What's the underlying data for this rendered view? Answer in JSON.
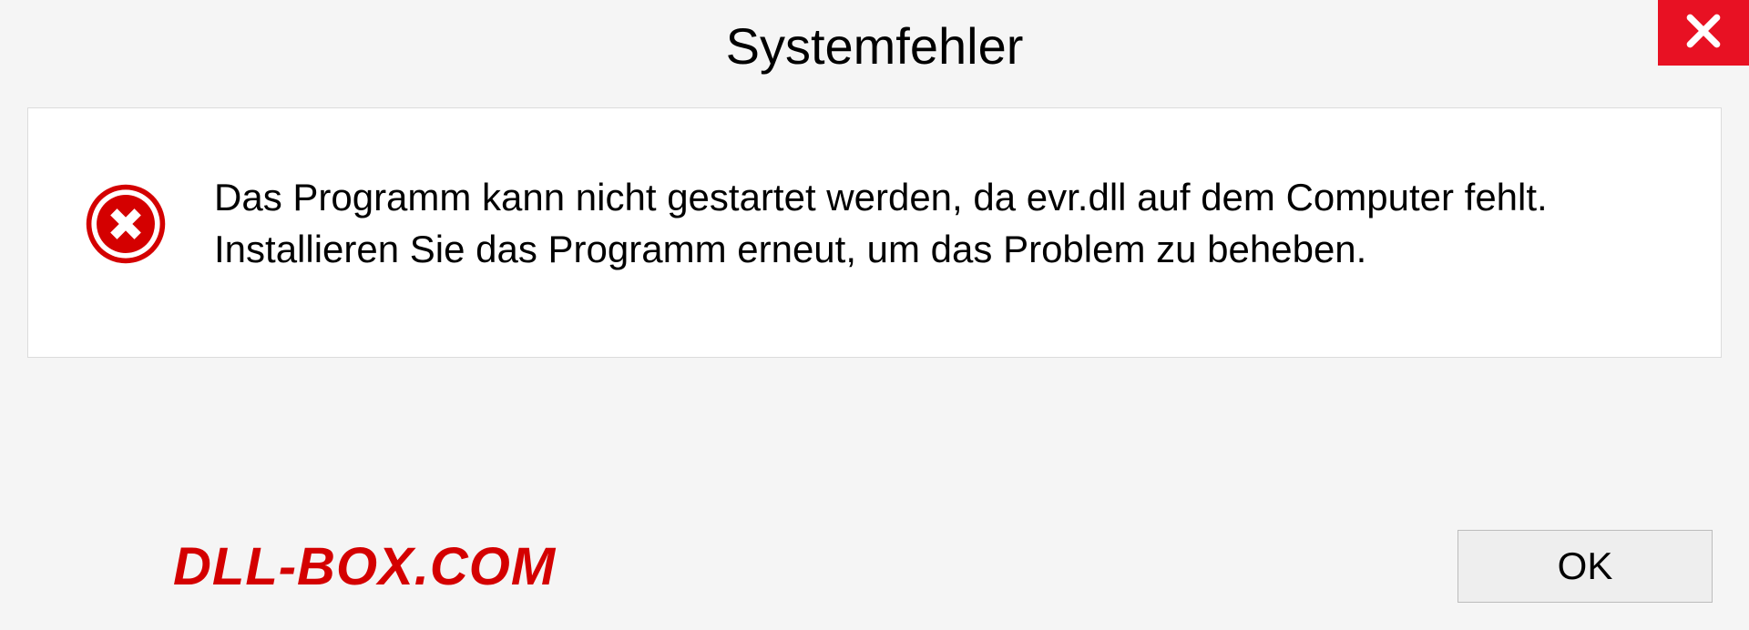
{
  "dialog": {
    "title": "Systemfehler",
    "message": "Das Programm kann nicht gestartet werden, da evr.dll auf dem Computer fehlt. Installieren Sie das Programm erneut, um das Problem zu beheben.",
    "ok_label": "OK"
  },
  "watermark": "DLL-BOX.COM"
}
